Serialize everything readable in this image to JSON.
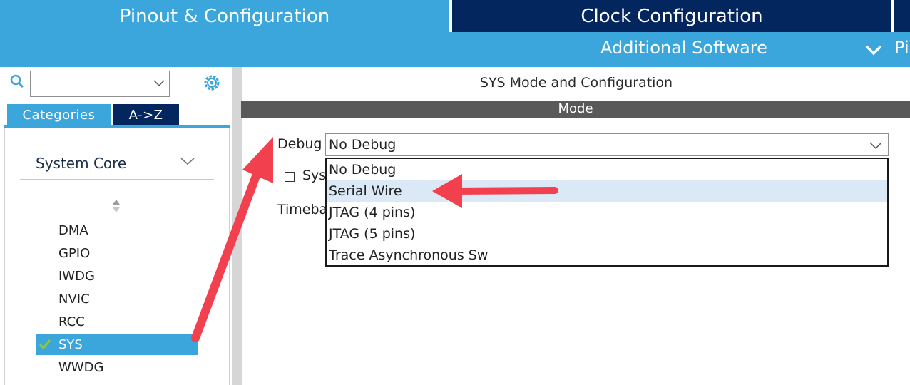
{
  "top_tabs": {
    "pinout": "Pinout & Configuration",
    "clock": "Clock Configuration"
  },
  "subbar": {
    "additional_software": "Additional Software",
    "cut_label": "Pi"
  },
  "left_panel": {
    "search": {
      "value": ""
    },
    "tabs": {
      "categories": "Categories",
      "az": "A->Z"
    },
    "group": "System Core",
    "items": [
      {
        "label": "DMA",
        "selected": false
      },
      {
        "label": "GPIO",
        "selected": false
      },
      {
        "label": "IWDG",
        "selected": false
      },
      {
        "label": "NVIC",
        "selected": false
      },
      {
        "label": "RCC",
        "selected": false
      },
      {
        "label": "SYS",
        "selected": true
      },
      {
        "label": "WWDG",
        "selected": false
      }
    ]
  },
  "main": {
    "title": "SYS Mode and Configuration",
    "mode_bar": "Mode",
    "debug_label": "Debug",
    "debug_value": "No Debug",
    "sys_label_partial": "Syst",
    "timebase_label_partial": "Timebase",
    "dropdown_options": [
      "No Debug",
      "Serial Wire",
      "JTAG (4 pins)",
      "JTAG (5 pins)",
      "Trace Asynchronous Sw"
    ],
    "highlighted_option": "Serial Wire"
  },
  "colors": {
    "accent_blue": "#3aa6dc",
    "navy": "#04265f",
    "mode_bar": "#595959",
    "highlight": "#dbe9f6",
    "annotation_arrow": "#f2404f",
    "check_green": "#8ec63f"
  },
  "icons": {
    "search": "search-icon",
    "gear": "gear-icon",
    "chevron": "chevron-down-icon",
    "sort": "sort-icon",
    "check": "check-icon"
  }
}
